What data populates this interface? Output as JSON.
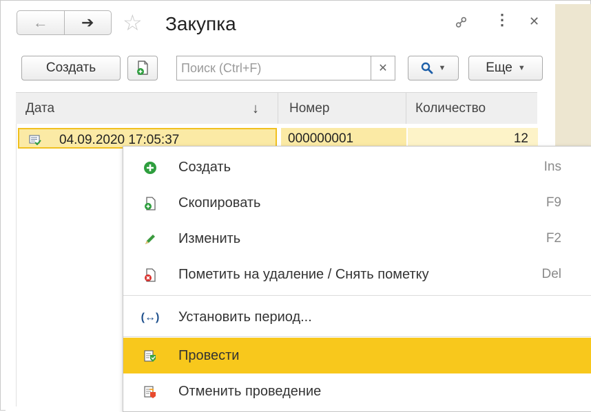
{
  "window": {
    "title": "Закупка",
    "icons": {
      "back": "arrow-left-icon",
      "forward": "arrow-right-icon",
      "favorite": "star-icon",
      "link": "link-icon",
      "menu": "more-vertical-icon",
      "close": "close-icon"
    }
  },
  "toolbar": {
    "create_label": "Создать",
    "search_placeholder": "Поиск (Ctrl+F)",
    "more_label": "Еще"
  },
  "table": {
    "columns": [
      "Дата",
      "Номер",
      "Количество"
    ],
    "rows": [
      {
        "date": "04.09.2020 17:05:37",
        "number": "000000001",
        "quantity": "12"
      }
    ]
  },
  "context_menu": {
    "items": [
      {
        "label": "Создать",
        "shortcut": "Ins",
        "icon": "add-icon"
      },
      {
        "label": "Скопировать",
        "shortcut": "F9",
        "icon": "copy-doc-icon"
      },
      {
        "label": "Изменить",
        "shortcut": "F2",
        "icon": "pencil-icon"
      },
      {
        "label": "Пометить на удаление / Снять пометку",
        "shortcut": "Del",
        "icon": "delete-mark-icon"
      },
      {
        "label": "Установить период...",
        "shortcut": "",
        "icon": "period-icon"
      },
      {
        "label": "Провести",
        "shortcut": "",
        "icon": "post-document-icon"
      },
      {
        "label": "Отменить проведение",
        "shortcut": "",
        "icon": "unpost-document-icon"
      }
    ],
    "highlighted_index": 5
  },
  "colors": {
    "accent": "#f8c81c",
    "row_selected": "#fbeaa5",
    "search_blue": "#1d5fa8"
  }
}
